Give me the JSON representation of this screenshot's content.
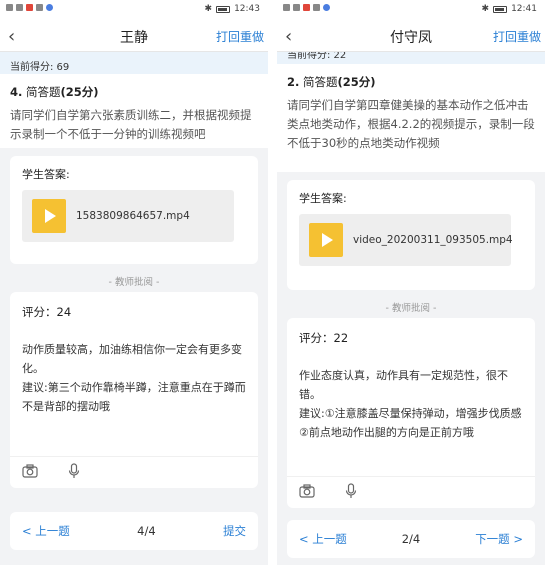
{
  "left": {
    "status": {
      "time": "12:43"
    },
    "nav": {
      "back": "‹",
      "title": "王静",
      "redo": "打回重做"
    },
    "score_text": "当前得分: 69",
    "question": {
      "number": "4.",
      "type": "简答题",
      "points": "(25分)",
      "text": "请同学们自学第六张素质训练二，并根据视频提示录制一个不低于一分钟的训练视频吧"
    },
    "answer_label": "学生答案:",
    "file_name": "1583809864657.mp4",
    "divider": "- 教师批阅 -",
    "comment": {
      "rating": "评分：24",
      "lines": [
        "动作质量较高，加油练相信你一定会有更多变化。",
        "建议:第三个动作靠椅半蹲，注意重点在于蹲而不是背部的摆动哦"
      ]
    },
    "footer": {
      "prev": "< 上一题",
      "page": "4/4",
      "next": "提交"
    }
  },
  "right": {
    "status": {
      "time": "12:41"
    },
    "nav": {
      "back": "‹",
      "title": "付守凤",
      "redo": "打回重做"
    },
    "score_text": "当前得分: 22",
    "question": {
      "number": "2.",
      "type": "简答题",
      "points": "(25分)",
      "text": "请同学们自学第四章健美操的基本动作之低冲击类点地类动作，根据4.2.2的视频提示，录制一段不低于30秒的点地类动作视频"
    },
    "answer_label": "学生答案:",
    "file_name": "video_20200311_093505.mp4",
    "divider": "- 教师批阅 -",
    "comment": {
      "rating": "评分：22",
      "lines": [
        "作业态度认真，动作具有一定规范性，很不错。",
        "建议:①注意膝盖尽量保持弹动，增强步伐质感",
        "②前点地动作出腿的方向是正前方哦"
      ]
    },
    "footer": {
      "prev": "< 上一题",
      "page": "2/4",
      "next": "下一题 >"
    }
  },
  "icons": {
    "camera": "camera-icon",
    "microphone": "microphone-icon",
    "play": "play-icon"
  },
  "colors": {
    "accent": "#2a7fd4",
    "play_button": "#f5c132",
    "score_bar": "#eaf3fb"
  }
}
